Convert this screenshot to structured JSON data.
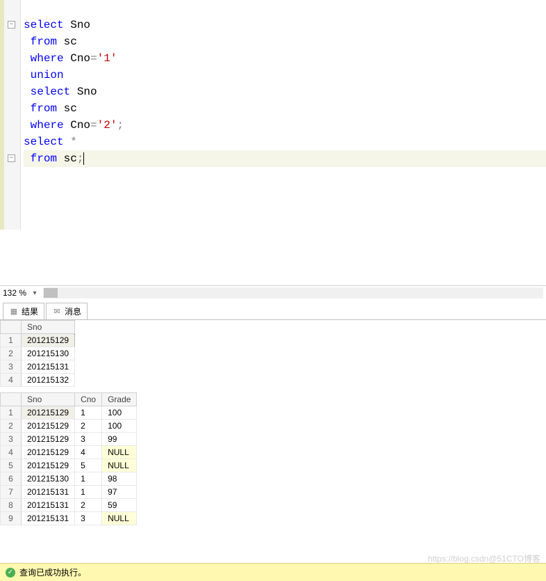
{
  "editor": {
    "lines": [
      {
        "indent": 0,
        "parts": [
          {
            "t": "  ",
            "c": ""
          }
        ],
        "fold": false,
        "partial_brace": true
      },
      {
        "indent": 0,
        "parts": [
          {
            "t": "select",
            "c": "kw-blue"
          },
          {
            "t": " Sno",
            "c": ""
          }
        ],
        "fold": true
      },
      {
        "indent": 1,
        "parts": [
          {
            "t": "from",
            "c": "kw-blue"
          },
          {
            "t": " sc",
            "c": ""
          }
        ]
      },
      {
        "indent": 1,
        "parts": [
          {
            "t": "where",
            "c": "kw-blue"
          },
          {
            "t": " Cno",
            "c": ""
          },
          {
            "t": "=",
            "c": "kw-gray"
          },
          {
            "t": "'1'",
            "c": "kw-red"
          }
        ]
      },
      {
        "indent": 1,
        "parts": [
          {
            "t": "union",
            "c": "kw-blue"
          }
        ]
      },
      {
        "indent": 1,
        "parts": [
          {
            "t": "select",
            "c": "kw-blue"
          },
          {
            "t": " Sno",
            "c": ""
          }
        ]
      },
      {
        "indent": 1,
        "parts": [
          {
            "t": "from",
            "c": "kw-blue"
          },
          {
            "t": " sc",
            "c": ""
          }
        ]
      },
      {
        "indent": 1,
        "parts": [
          {
            "t": "where",
            "c": "kw-blue"
          },
          {
            "t": " Cno",
            "c": ""
          },
          {
            "t": "=",
            "c": "kw-gray"
          },
          {
            "t": "'2'",
            "c": "kw-red"
          },
          {
            "t": ";",
            "c": "kw-gray"
          }
        ]
      },
      {
        "indent": 0,
        "parts": []
      },
      {
        "indent": 0,
        "parts": [
          {
            "t": "select",
            "c": "kw-blue"
          },
          {
            "t": " ",
            "c": ""
          },
          {
            "t": "*",
            "c": "kw-gray"
          }
        ],
        "fold": true
      },
      {
        "indent": 1,
        "parts": [
          {
            "t": "from",
            "c": "kw-blue"
          },
          {
            "t": " sc",
            "c": ""
          },
          {
            "t": ";",
            "c": "kw-gray"
          }
        ],
        "highlight": true,
        "cursor": true
      }
    ]
  },
  "zoom": "132 %",
  "tabs": {
    "results": "结果",
    "messages": "消息"
  },
  "grid1": {
    "cols": [
      "Sno"
    ],
    "rows": [
      [
        "201215129"
      ],
      [
        "201215130"
      ],
      [
        "201215131"
      ],
      [
        "201215132"
      ]
    ]
  },
  "grid2": {
    "cols": [
      "Sno",
      "Cno",
      "Grade"
    ],
    "rows": [
      [
        "201215129",
        "1",
        "100"
      ],
      [
        "201215129",
        "2",
        "100"
      ],
      [
        "201215129",
        "3",
        "99"
      ],
      [
        "201215129",
        "4",
        "NULL"
      ],
      [
        "201215129",
        "5",
        "NULL"
      ],
      [
        "201215130",
        "1",
        "98"
      ],
      [
        "201215131",
        "1",
        "97"
      ],
      [
        "201215131",
        "2",
        "59"
      ],
      [
        "201215131",
        "3",
        "NULL"
      ]
    ]
  },
  "status": "查询已成功执行。",
  "watermark": "https://blog.csdn@51CTO博客"
}
